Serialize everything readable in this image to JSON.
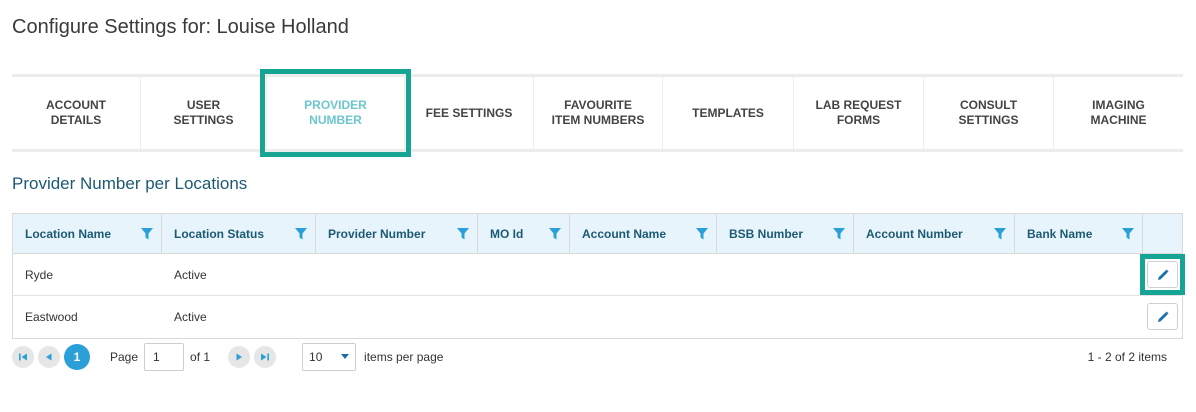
{
  "page": {
    "title": "Configure Settings for: Louise Holland"
  },
  "tabs": [
    {
      "label": "ACCOUNT\nDETAILS",
      "active": false
    },
    {
      "label": "USER\nSETTINGS",
      "active": false
    },
    {
      "label": "PROVIDER\nNUMBER",
      "active": true
    },
    {
      "label": "FEE SETTINGS",
      "active": false
    },
    {
      "label": "FAVOURITE\nITEM NUMBERS",
      "active": false
    },
    {
      "label": "TEMPLATES",
      "active": false
    },
    {
      "label": "LAB REQUEST\nFORMS",
      "active": false
    },
    {
      "label": "CONSULT\nSETTINGS",
      "active": false
    },
    {
      "label": "IMAGING\nMACHINE",
      "active": false
    }
  ],
  "section": {
    "title": "Provider Number per Locations"
  },
  "grid": {
    "columns": [
      "Location Name",
      "Location Status",
      "Provider Number",
      "MO Id",
      "Account Name",
      "BSB Number",
      "Account Number",
      "Bank Name"
    ],
    "rows": [
      {
        "cells": [
          "Ryde",
          "Active",
          "",
          "",
          "",
          "",
          "",
          ""
        ]
      },
      {
        "cells": [
          "Eastwood",
          "Active",
          "",
          "",
          "",
          "",
          "",
          ""
        ]
      }
    ]
  },
  "pager": {
    "current_page": "1",
    "page_label": "Page",
    "page_value": "1",
    "of_label": "of 1",
    "page_size": "10",
    "items_per_page_label": "items per page",
    "summary": "1 - 2 of 2 items"
  },
  "colors": {
    "accent": "#6cc7cd",
    "highlight": "#16a594",
    "header_bg": "#e8f4fb",
    "header_text": "#1c5a74",
    "pager_active": "#2a9fd8"
  }
}
